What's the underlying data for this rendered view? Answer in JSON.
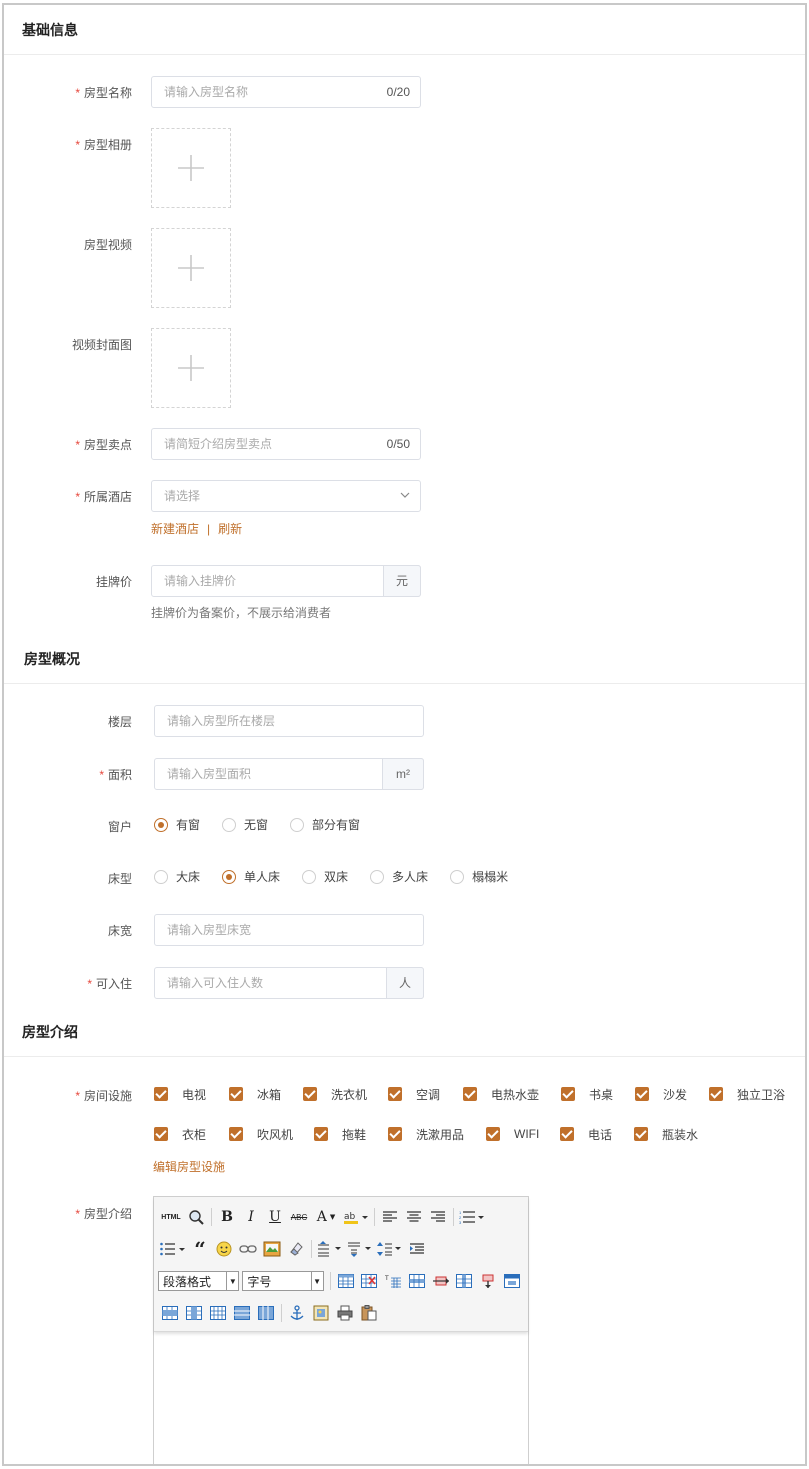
{
  "sections": {
    "basic": "基础信息",
    "overview": "房型概况",
    "intro": "房型介绍"
  },
  "basic": {
    "name_label": "房型名称",
    "name_placeholder": "请输入房型名称",
    "name_count": "0/20",
    "album_label": "房型相册",
    "video_label": "房型视频",
    "cover_label": "视频封面图",
    "selling_label": "房型卖点",
    "selling_placeholder": "请简短介绍房型卖点",
    "selling_count": "0/50",
    "hotel_label": "所属酒店",
    "hotel_placeholder": "请选择",
    "new_hotel_link": "新建酒店",
    "link_separator": "|",
    "refresh_link": "刷新",
    "price_label": "挂牌价",
    "price_placeholder": "请输入挂牌价",
    "price_unit": "元",
    "price_hint": "挂牌价为备案价，不展示给消费者"
  },
  "overview": {
    "floor_label": "楼层",
    "floor_placeholder": "请输入房型所在楼层",
    "area_label": "面积",
    "area_placeholder": "请输入房型面积",
    "area_unit": "m²",
    "window_label": "窗户",
    "window_options": [
      "有窗",
      "无窗",
      "部分有窗"
    ],
    "window_selected": 0,
    "bed_label": "床型",
    "bed_options": [
      "大床",
      "单人床",
      "双床",
      "多人床",
      "榻榻米"
    ],
    "bed_selected": 1,
    "bed_width_label": "床宽",
    "bed_width_placeholder": "请输入房型床宽",
    "occupancy_label": "可入住",
    "occupancy_placeholder": "请输入可入住人数",
    "occupancy_unit": "人"
  },
  "intro": {
    "facilities_label": "房间设施",
    "facilities_row1": [
      "电视",
      "冰箱",
      "洗衣机",
      "空调",
      "电热水壶",
      "书桌",
      "沙发",
      "独立卫浴"
    ],
    "facilities_row2": [
      "衣柜",
      "吹风机",
      "拖鞋",
      "洗漱用品",
      "WIFI",
      "电话",
      "瓶装水"
    ],
    "edit_facilities_link": "编辑房型设施",
    "description_label": "房型介绍",
    "editor": {
      "html_btn": "HTML",
      "paragraph_select": "段落格式",
      "font_size_select": "字号"
    }
  },
  "colors": {
    "accent": "#c0702b",
    "required": "#e6473c",
    "border": "#dcdfe6"
  }
}
